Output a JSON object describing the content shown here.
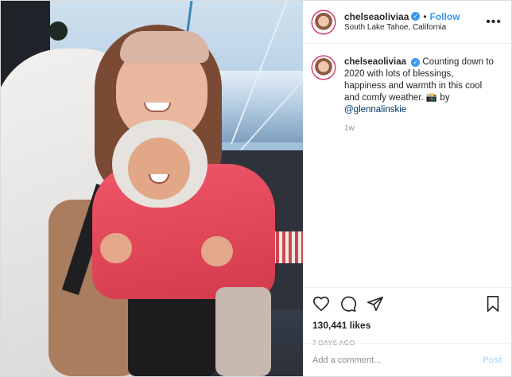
{
  "header": {
    "username": "chelseaoliviaa",
    "verified_icon": "verified-badge-icon",
    "separator": "•",
    "follow_label": "Follow",
    "location": "South Lake Tahoe, California",
    "more_icon": "more-options-icon"
  },
  "caption": {
    "username": "chelseaoliviaa",
    "text": "Counting down to 2020 with lots of blessings, happiness and warmth in this cool and comfy weather. 📸 by ",
    "mention": "@glennalinskie",
    "time": "1w"
  },
  "actions": {
    "like_icon": "heart-icon",
    "comment_icon": "comment-icon",
    "share_icon": "share-icon",
    "save_icon": "bookmark-icon",
    "likes": "130,441 likes",
    "posted": "7 DAYS AGO"
  },
  "comment_box": {
    "placeholder": "Add a comment...",
    "post_label": "Post"
  },
  "colors": {
    "accent": "#3897f0",
    "post_disabled": "#b2dffc",
    "muted": "#8e8e8e",
    "mention": "#003569"
  }
}
